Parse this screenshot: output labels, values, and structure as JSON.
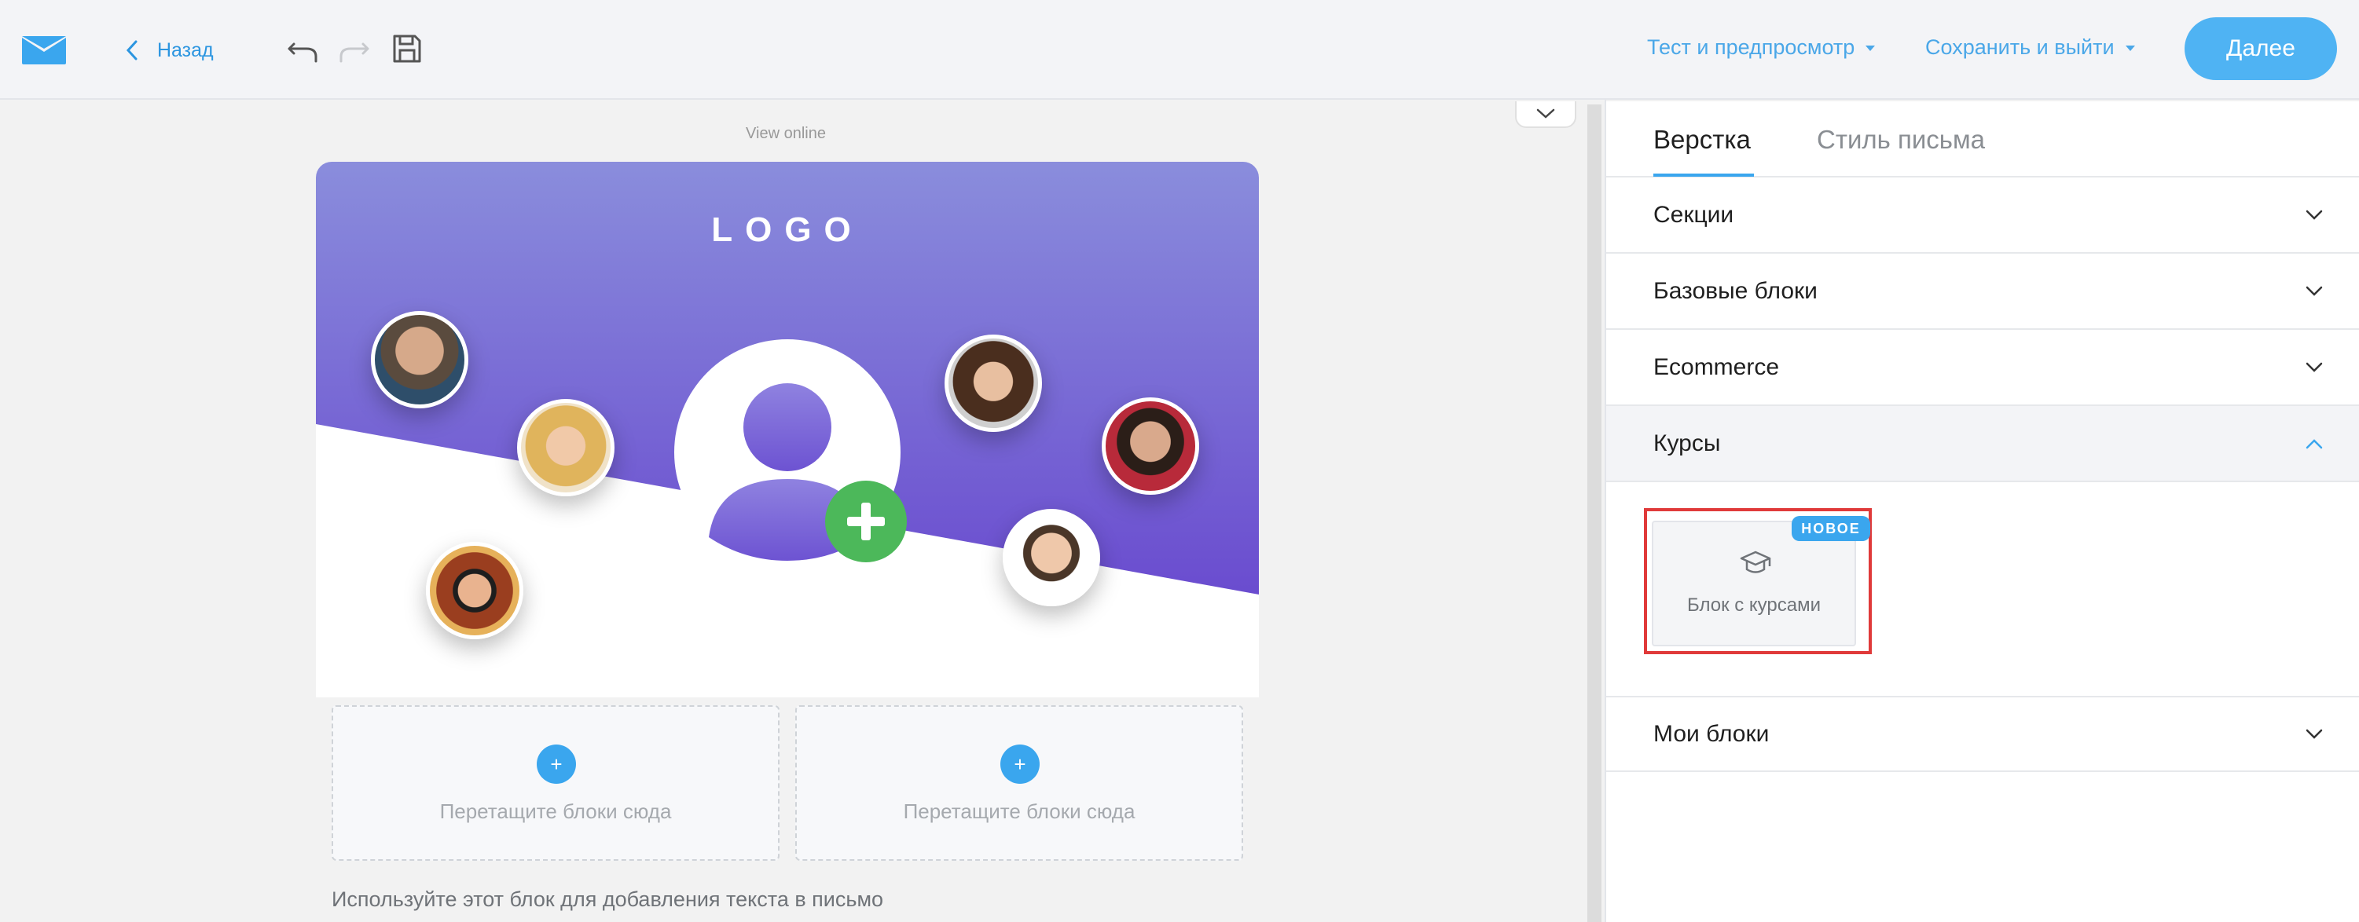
{
  "toolbar": {
    "back_label": "Назад",
    "test_label": "Тест и предпросмотр",
    "save_exit_label": "Сохранить и выйти",
    "next_label": "Далее"
  },
  "canvas": {
    "view_online": "View online",
    "logo_text": "LOGO",
    "dropzones": [
      {
        "label": "Перетащите блоки сюда",
        "plus": "+"
      },
      {
        "label": "Перетащите блоки сюда",
        "plus": "+"
      }
    ],
    "text_hint": "Используйте этот блок для добавления текста в письмо"
  },
  "panel": {
    "tabs": [
      {
        "label": "Верстка",
        "active": true
      },
      {
        "label": "Стиль письма",
        "active": false
      }
    ],
    "sections": [
      {
        "label": "Секции",
        "expanded": false
      },
      {
        "label": "Базовые блоки",
        "expanded": false
      },
      {
        "label": "Ecommerce",
        "expanded": false
      },
      {
        "label": "Курсы",
        "expanded": true
      },
      {
        "label": "Мои блоки",
        "expanded": false
      }
    ],
    "course_block": {
      "label": "Блок с курсами",
      "badge": "НОВОЕ",
      "icon": "graduation-cap-icon"
    }
  },
  "colors": {
    "accent": "#4fb3f3",
    "link": "#2b95e0",
    "header_gradient_top": "#8a8ddc",
    "header_gradient_bottom": "#6a4ccf",
    "add_green": "#4cb85a",
    "highlight_red": "#e03a3a"
  }
}
